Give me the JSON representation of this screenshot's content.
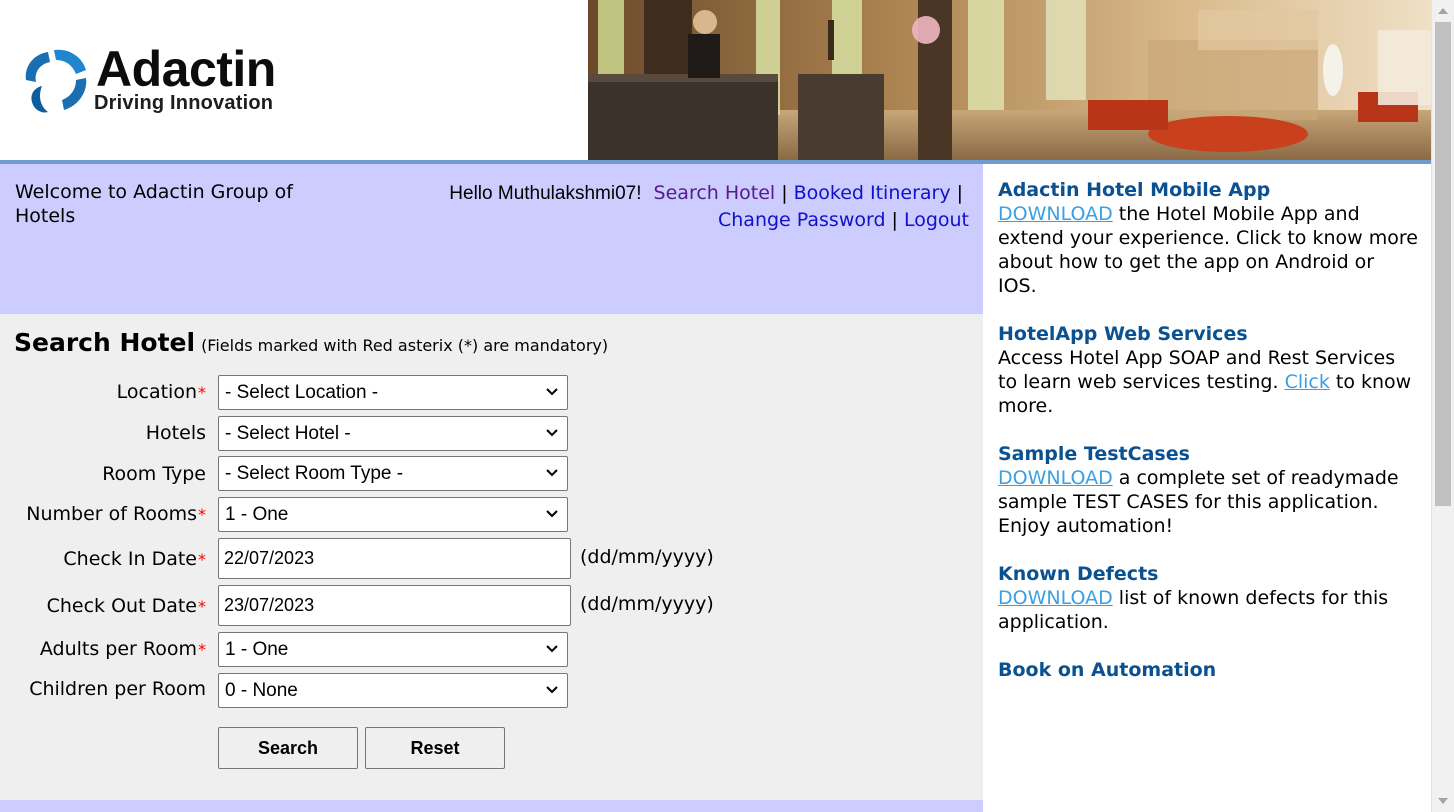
{
  "brand": {
    "name": "Adactin",
    "tagline": "Driving Innovation"
  },
  "welcome": {
    "text": "Welcome to Adactin Group of Hotels"
  },
  "nav": {
    "hello": "Hello Muthulakshmi07!",
    "search_hotel": "Search Hotel",
    "booked_itinerary": "Booked Itinerary",
    "separator": "|",
    "change_password": "Change Password",
    "logout": "Logout"
  },
  "form": {
    "title": "Search Hotel",
    "subtitle": "(Fields marked with Red asterix (*) are mandatory)",
    "required_mark": "*",
    "fields": {
      "location": {
        "label": "Location",
        "value": "- Select Location -"
      },
      "hotels": {
        "label": "Hotels",
        "value": "- Select Hotel -"
      },
      "room_type": {
        "label": "Room Type",
        "value": "- Select Room Type -"
      },
      "num_rooms": {
        "label": "Number of Rooms",
        "value": "1 - One"
      },
      "check_in": {
        "label": "Check In Date",
        "value": "22/07/2023",
        "format": "(dd/mm/yyyy)"
      },
      "check_out": {
        "label": "Check Out Date",
        "value": "23/07/2023",
        "format": "(dd/mm/yyyy)"
      },
      "adults": {
        "label": "Adults per Room",
        "value": "1 - One"
      },
      "children": {
        "label": "Children per Room",
        "value": "0 - None"
      }
    },
    "search_button": "Search",
    "reset_button": "Reset"
  },
  "sidebar": {
    "mobile_app": {
      "title": "Adactin Hotel Mobile App",
      "link": "DOWNLOAD",
      "text": " the Hotel Mobile App and extend your experience. Click to know more about how to get the app on Android or IOS."
    },
    "web_services": {
      "title": "HotelApp Web Services",
      "text_before": "Access Hotel App SOAP and Rest Services to learn web services testing. ",
      "link": "Click",
      "text_after": " to know more."
    },
    "test_cases": {
      "title": "Sample TestCases",
      "link": "DOWNLOAD",
      "text": " a complete set of readymade sample TEST CASES for this application. Enjoy automation!"
    },
    "defects": {
      "title": "Known Defects",
      "link": "DOWNLOAD",
      "text": " list of known defects for this application."
    },
    "book": {
      "title": "Book on Automation"
    }
  },
  "colors": {
    "welcome_bg": "#ccccfe",
    "form_bg": "#efefef",
    "sidebar_title": "#0a5192",
    "sidebar_link": "#3aa0e4",
    "nav_link": "#1111cc",
    "nav_visited": "#551a8b",
    "required": "#ff0000",
    "header_border": "#6e9ccf"
  },
  "icons": {
    "logo": "adactin-logo-icon",
    "dropdown": "chevron-down-icon"
  }
}
